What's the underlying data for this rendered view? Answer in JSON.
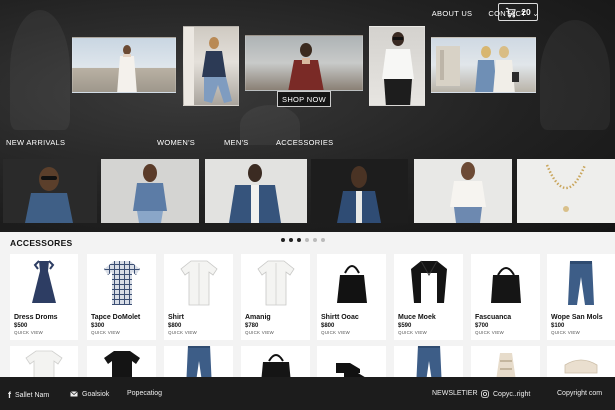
{
  "nav": {
    "about": "ABOUT US",
    "contact": "CONTACT",
    "cart_count": "20"
  },
  "hero": {
    "cta": "SHOP NOW"
  },
  "categories": {
    "new_arrivals": "NEW ARRIVALS",
    "womens": "WOMEN'S",
    "mens": "MEN'S",
    "accessories": "ACCESSORIES"
  },
  "accessories": {
    "title": "ACCESSORES",
    "dots_total": 6,
    "dots_active": 3,
    "row1": [
      {
        "name": "Dress Droms",
        "price": "$500",
        "quick": "QUICK VIEW",
        "icon": "dress"
      },
      {
        "name": "Tapce DoMolet",
        "price": "$300",
        "quick": "QUICK VIEW",
        "icon": "plaid-shirt"
      },
      {
        "name": "Shirt",
        "price": "$800",
        "quick": "QUICK VIEW",
        "icon": "white-shirt"
      },
      {
        "name": "Amanig",
        "price": "$780",
        "quick": "QUICK VIEW",
        "icon": "white-shirt"
      },
      {
        "name": "Shirtt Ooac",
        "price": "$800",
        "quick": "QUICK VIEW",
        "icon": "handbag"
      },
      {
        "name": "Muce Moek",
        "price": "$590",
        "quick": "QUICK VIEW",
        "icon": "leather-jacket"
      },
      {
        "name": "Fascuanca",
        "price": "$700",
        "quick": "QUICK VIEW",
        "icon": "tote-bag"
      },
      {
        "name": "Wope San Mols",
        "price": "$100",
        "quick": "QUICK VIEW",
        "icon": "jeans"
      }
    ],
    "row2_icons": [
      "white-tee",
      "black-sweater",
      "jeans",
      "black-bag",
      "black-shoes",
      "jeans",
      "beige-sandal",
      "beige-loafer"
    ]
  },
  "footer": {
    "facebook": "Sallet Nam",
    "email": "Goalsiok",
    "catalog": "Popecatiog",
    "newsletter": "NEWSLETIER",
    "instagram": "Copyc..right",
    "copyright": "Copyright com"
  },
  "colors": {
    "dark": "#1c1c1c",
    "panel": "#f3f3f3",
    "denim": "#3b5b84"
  }
}
